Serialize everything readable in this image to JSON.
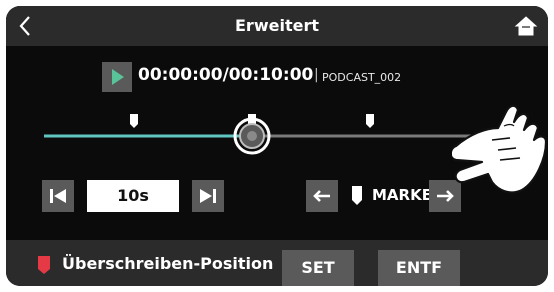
{
  "header": {
    "title": "Erweitert",
    "back_icon": "chevron-left-icon",
    "home_icon": "home-icon"
  },
  "transport": {
    "play_icon": "play-icon",
    "time": "00:00:00/00:10:00",
    "separator": "|",
    "filename": "PODCAST_002"
  },
  "timeline": {
    "progress": 0.48,
    "mark_icon": "marker-icon"
  },
  "controls": {
    "prev_icon": "skip-previous-icon",
    "skip_value": "10s",
    "next_icon": "skip-next-icon",
    "marke_prev_icon": "arrow-left-icon",
    "marke_label": "MARKE",
    "marke_next_icon": "arrow-right-icon"
  },
  "footer": {
    "overwrite_label": "Überschreiben-Position",
    "set_label": "SET",
    "delete_label": "ENTF"
  },
  "colors": {
    "accent": "#5fc5c0",
    "play": "#59c39a",
    "red_marker": "#e53946",
    "panel": "#2b2b2b",
    "button": "#5a5a5a"
  }
}
